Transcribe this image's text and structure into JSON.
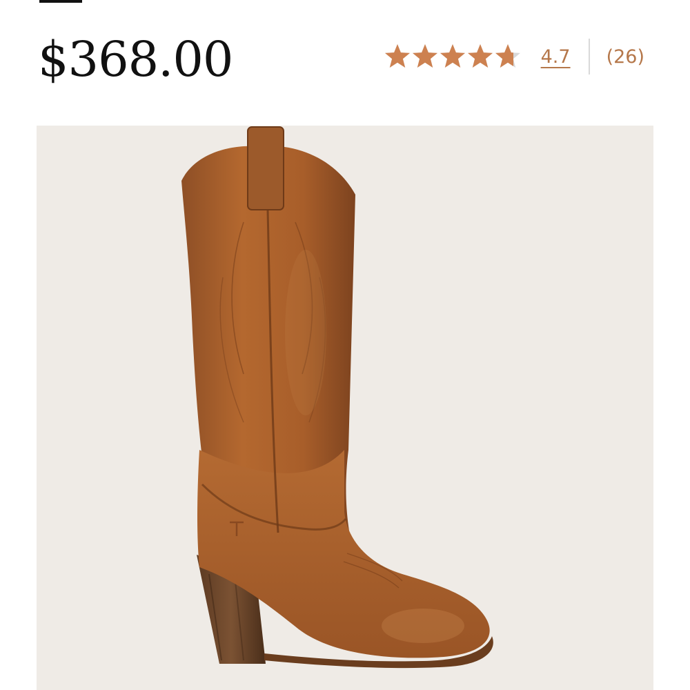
{
  "product": {
    "price": "$368.00",
    "rating": {
      "value": "4.7",
      "stars_out_of": 5,
      "stars_filled": 4.7,
      "review_count": "(26)"
    },
    "image": {
      "subject": "tall-brown-leather-western-boot-icon",
      "background_color": "#efebe6"
    }
  },
  "colors": {
    "star_fill": "#cd8150",
    "star_empty": "#d8d8d8",
    "accent_text": "#b5774a",
    "price_text": "#111111"
  }
}
